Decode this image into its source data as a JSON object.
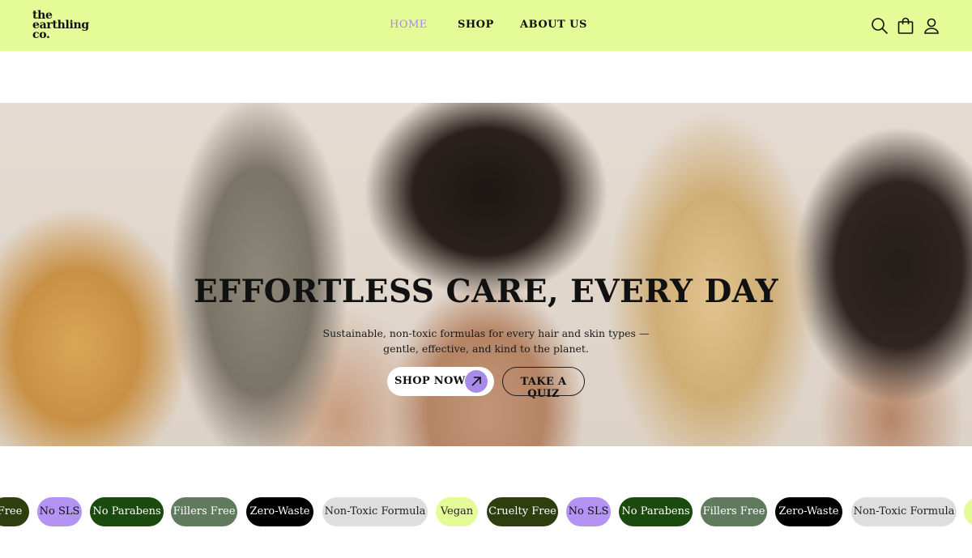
{
  "header": {
    "logo": [
      "the",
      "earthling",
      "co."
    ],
    "nav": [
      {
        "label": "HOME",
        "active": true
      },
      {
        "label": "SHOP",
        "active": false
      },
      {
        "label": "ABOUT US",
        "active": false
      }
    ],
    "icons": [
      "search-icon",
      "shopping-bag-icon",
      "user-icon"
    ],
    "background": "#e5fb98",
    "accent": "#a78be8"
  },
  "hero": {
    "title": "EFFORTLESS CARE, EVERY DAY",
    "subtitle_line1": "Sustainable, non-toxic formulas for every hair and skin types —",
    "subtitle_line2": "gentle, effective, and kind to the planet.",
    "primary_button": "SHOP NOW",
    "secondary_button": "TAKE A QUIZ"
  },
  "tags": [
    {
      "label": "Free",
      "style": "t-dk"
    },
    {
      "label": "No SLS",
      "style": "t-pu"
    },
    {
      "label": "No Parabens",
      "style": "t-gr"
    },
    {
      "label": "Fillers Free",
      "style": "t-sg"
    },
    {
      "label": "Zero-Waste",
      "style": "t-bk"
    },
    {
      "label": "Non-Toxic Formula",
      "style": "t-lg"
    },
    {
      "label": "Vegan",
      "style": "t-lm"
    },
    {
      "label": "Cruelty Free",
      "style": "t-dk"
    },
    {
      "label": "No SLS",
      "style": "t-pu"
    },
    {
      "label": "No Parabens",
      "style": "t-gr"
    },
    {
      "label": "Fillers Free",
      "style": "t-sg"
    },
    {
      "label": "Zero-Waste",
      "style": "t-bk"
    },
    {
      "label": "Non-Toxic Formula",
      "style": "t-lg"
    },
    {
      "label": "",
      "style": "t-lm"
    }
  ]
}
